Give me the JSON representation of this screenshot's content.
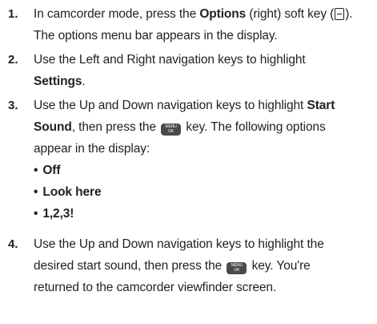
{
  "steps": [
    {
      "number": "1.",
      "line1_pre": "In camcorder mode, press the ",
      "line1_bold": "Options",
      "line1_post": " (right) soft key (",
      "line1_end": ").",
      "line2": "The options menu bar appears in the display."
    },
    {
      "number": "2.",
      "line1": "Use the Left and Right navigation keys to highlight",
      "line2_bold": "Settings",
      "line2_end": "."
    },
    {
      "number": "3.",
      "line1_pre": "Use the Up and Down navigation keys to highlight ",
      "line1_bold": "Start",
      "line2_bold": "Sound",
      "line2_mid": ", then press the ",
      "line2_post": " key. The following options",
      "line3": "appear in the display:",
      "options": [
        "Off",
        "Look here",
        "1,2,3!"
      ]
    },
    {
      "number": "4.",
      "line1": "Use the Up and Down navigation keys to highlight the",
      "line2_pre": "desired start sound, then press the ",
      "line2_post": " key. You're",
      "line3": "returned to the camcorder viewfinder screen."
    }
  ],
  "icons": {
    "softkey": "right-softkey-icon",
    "menu_ok_top": "MENU",
    "menu_ok_bottom": "OK"
  },
  "bullet_symbol": "•"
}
